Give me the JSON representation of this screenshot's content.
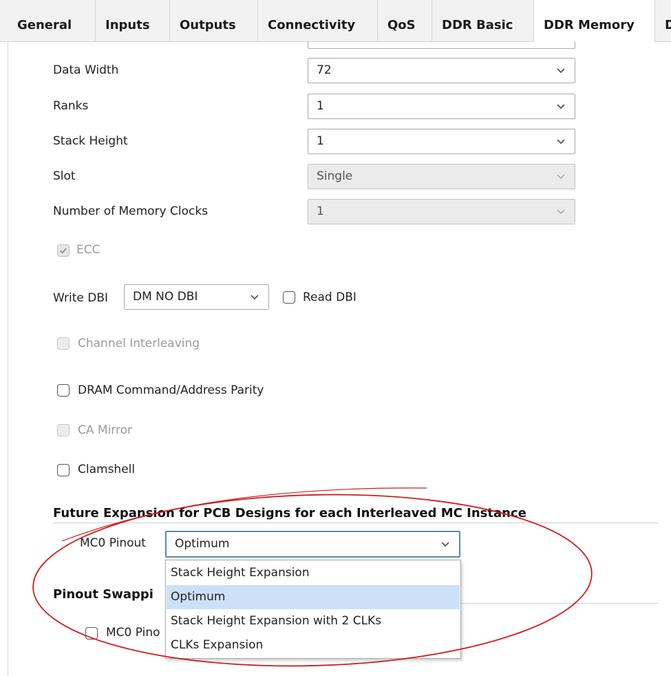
{
  "tabs": [
    {
      "label": "General"
    },
    {
      "label": "Inputs"
    },
    {
      "label": "Outputs"
    },
    {
      "label": "Connectivity"
    },
    {
      "label": "QoS"
    },
    {
      "label": "DDR Basic"
    },
    {
      "label": "DDR Memory"
    },
    {
      "label": "D"
    }
  ],
  "top_partial_combo": {
    "value": ""
  },
  "fields": [
    {
      "label": "Data Width",
      "value": "72"
    },
    {
      "label": "Ranks",
      "value": "1"
    },
    {
      "label": "Stack Height",
      "value": "1"
    },
    {
      "label": "Slot",
      "value": "Single"
    },
    {
      "label": "Number of Memory Clocks",
      "value": "1"
    }
  ],
  "ecc": {
    "label": "ECC",
    "checked": true
  },
  "write_dbi": {
    "label": "Write DBI",
    "value": "DM NO DBI"
  },
  "read_dbi": {
    "label": "Read DBI",
    "checked": false
  },
  "channel_interleaving": {
    "label": "Channel Interleaving",
    "checked": false
  },
  "dram_parity": {
    "label": "DRAM Command/Address Parity",
    "checked": false
  },
  "ca_mirror": {
    "label": "CA Mirror",
    "checked": false
  },
  "clamshell": {
    "label": "Clamshell",
    "checked": false
  },
  "future_expansion": {
    "title": "Future Expansion for PCB Designs for each Interleaved MC Instance",
    "mc0_label": "MC0 Pinout",
    "mc0_value": "Optimum",
    "options": [
      {
        "label": "Stack Height Expansion"
      },
      {
        "label": "Optimum"
      },
      {
        "label": "Stack Height Expansion with 2 CLKs"
      },
      {
        "label": "CLKs Expansion"
      }
    ]
  },
  "pinout_swapping": {
    "title": "Pinout Swappi",
    "mc0_checkbox_label": "MC0 Pino"
  },
  "colors": {
    "annotation": "#d01c1c",
    "selected_option": "#cce0f7",
    "focus_border": "#5a87b8"
  }
}
